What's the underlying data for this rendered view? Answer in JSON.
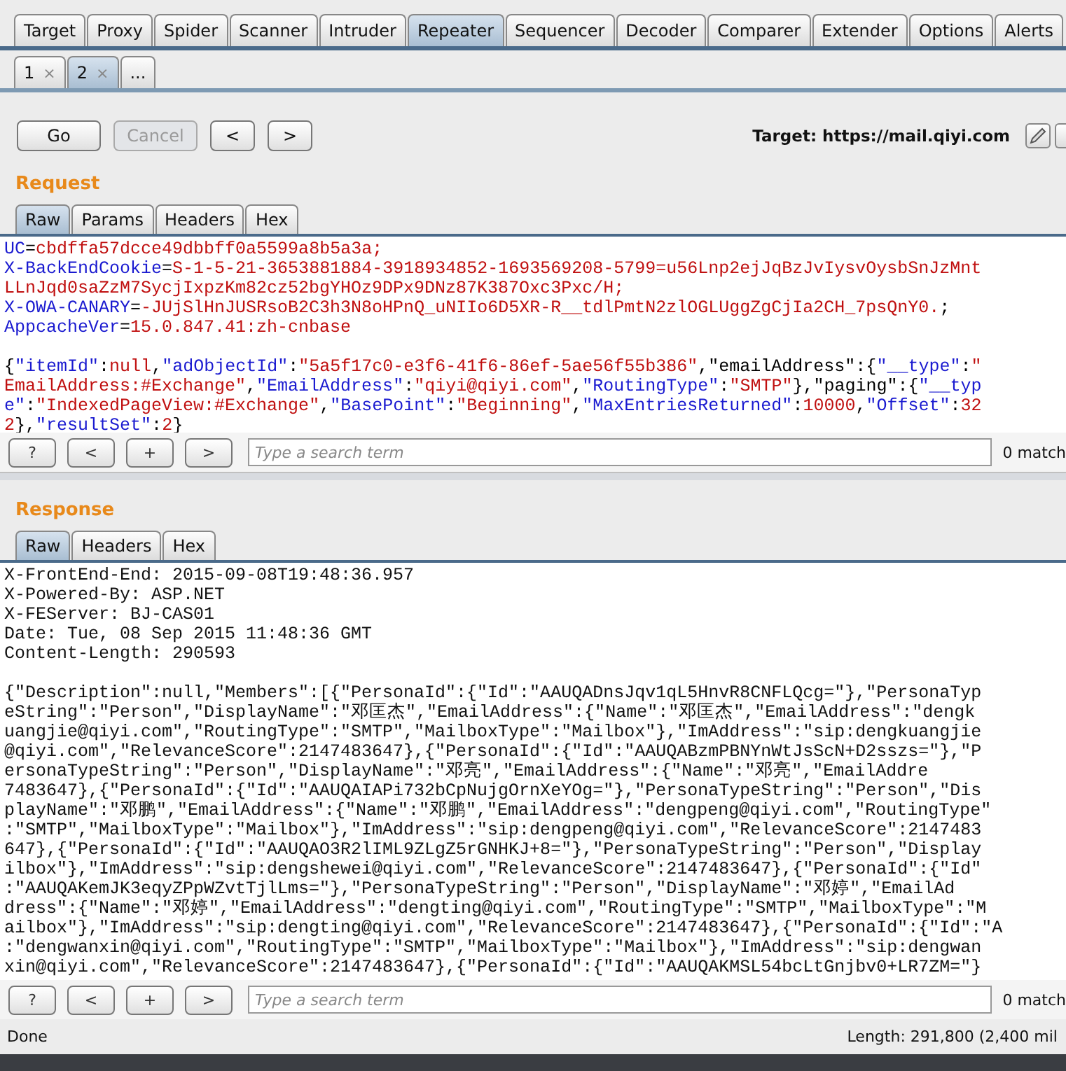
{
  "main_tabs": [
    {
      "label": "Target",
      "selected": false
    },
    {
      "label": "Proxy",
      "selected": false
    },
    {
      "label": "Spider",
      "selected": false
    },
    {
      "label": "Scanner",
      "selected": false
    },
    {
      "label": "Intruder",
      "selected": false
    },
    {
      "label": "Repeater",
      "selected": true
    },
    {
      "label": "Sequencer",
      "selected": false
    },
    {
      "label": "Decoder",
      "selected": false
    },
    {
      "label": "Comparer",
      "selected": false
    },
    {
      "label": "Extender",
      "selected": false
    },
    {
      "label": "Options",
      "selected": false
    },
    {
      "label": "Alerts",
      "selected": false
    }
  ],
  "repeater_tabs": [
    {
      "label": "1",
      "close": "×",
      "selected": false
    },
    {
      "label": "2",
      "close": "×",
      "selected": true
    },
    {
      "label": "...",
      "selected": false
    }
  ],
  "toolbar": {
    "buttons": [
      {
        "label": "Go",
        "disabled": false
      },
      {
        "label": "Cancel",
        "disabled": true
      },
      {
        "label": "<",
        "disabled": false
      },
      {
        "label": ">",
        "disabled": false
      }
    ],
    "target": "Target: https://mail.qiyi.com"
  },
  "request": {
    "title": "Request",
    "tabs": [
      {
        "label": "Raw",
        "selected": true
      },
      {
        "label": "Params",
        "selected": false
      },
      {
        "label": "Headers",
        "selected": false
      },
      {
        "label": "Hex",
        "selected": false
      }
    ],
    "header_lines": [
      [
        {
          "kind": "key",
          "text": "UC"
        },
        {
          "kind": "plain",
          "text": "="
        },
        {
          "kind": "value",
          "text": "cbdffa57dcce49dbbff0a5599a8b5a3a;"
        }
      ],
      [
        {
          "kind": "key",
          "text": "X-BackEndCookie"
        },
        {
          "kind": "plain",
          "text": "="
        },
        {
          "kind": "value",
          "text": "S-1-5-21-3653881884-3918934852-1693569208-5799=u56Lnp2ejJqBzJvIysvOysbSnJzMnt"
        }
      ],
      [
        {
          "kind": "value",
          "text": "LLnJqd0saZzM7SycjIxpzKm82cz52bgYHOz9DPx9DNz87K387Oxc3Pxc/H;"
        }
      ],
      [
        {
          "kind": "key",
          "text": "X-OWA-CANARY"
        },
        {
          "kind": "plain",
          "text": "="
        },
        {
          "kind": "value",
          "text": "-JUjSlHnJUSRsoB2C3h3N8oHPnQ_uNIIo6D5XR-R__tdlPmtN2zlOGLUggZgCjIa2CH_7psQnY0."
        },
        {
          "kind": "plain",
          "text": ";"
        }
      ],
      [
        {
          "kind": "key",
          "text": "AppcacheVer"
        },
        {
          "kind": "plain",
          "text": "="
        },
        {
          "kind": "value",
          "text": "15.0.847.41:zh-cnbase"
        }
      ]
    ],
    "body_lines": [
      [
        {
          "kind": "plain",
          "text": "{"
        },
        {
          "kind": "key",
          "text": "\"itemId\""
        },
        {
          "kind": "plain",
          "text": ":"
        },
        {
          "kind": "value",
          "text": "null"
        },
        {
          "kind": "plain",
          "text": ","
        },
        {
          "kind": "key",
          "text": "\"adObjectId\""
        },
        {
          "kind": "plain",
          "text": ":"
        },
        {
          "kind": "value",
          "text": "\"5a5f17c0-e3f6-41f6-86ef-5ae56f55b386\""
        },
        {
          "kind": "plain",
          "text": ",\"emailAddress\":{"
        },
        {
          "kind": "key",
          "text": "\"__type\""
        },
        {
          "kind": "plain",
          "text": ":"
        },
        {
          "kind": "value",
          "text": "\""
        }
      ],
      [
        {
          "kind": "value",
          "text": "EmailAddress:#Exchange\""
        },
        {
          "kind": "plain",
          "text": ","
        },
        {
          "kind": "key",
          "text": "\"EmailAddress\""
        },
        {
          "kind": "plain",
          "text": ":"
        },
        {
          "kind": "value",
          "text": "\"qiyi@qiyi.com\""
        },
        {
          "kind": "plain",
          "text": ","
        },
        {
          "kind": "key",
          "text": "\"RoutingType\""
        },
        {
          "kind": "plain",
          "text": ":"
        },
        {
          "kind": "value",
          "text": "\"SMTP\""
        },
        {
          "kind": "plain",
          "text": "},\"paging\":{"
        },
        {
          "kind": "key",
          "text": "\"__typ"
        }
      ],
      [
        {
          "kind": "key",
          "text": "e\""
        },
        {
          "kind": "plain",
          "text": ":"
        },
        {
          "kind": "value",
          "text": "\"IndexedPageView:#Exchange\""
        },
        {
          "kind": "plain",
          "text": ","
        },
        {
          "kind": "key",
          "text": "\"BasePoint\""
        },
        {
          "kind": "plain",
          "text": ":"
        },
        {
          "kind": "value",
          "text": "\"Beginning\""
        },
        {
          "kind": "plain",
          "text": ","
        },
        {
          "kind": "key",
          "text": "\"MaxEntriesReturned\""
        },
        {
          "kind": "plain",
          "text": ":"
        },
        {
          "kind": "value",
          "text": "10000"
        },
        {
          "kind": "plain",
          "text": ","
        },
        {
          "kind": "key",
          "text": "\"Offset\""
        },
        {
          "kind": "plain",
          "text": ":"
        },
        {
          "kind": "value",
          "text": "32"
        }
      ],
      [
        {
          "kind": "value",
          "text": "2"
        },
        {
          "kind": "plain",
          "text": "},"
        },
        {
          "kind": "key",
          "text": "\"resultSet\""
        },
        {
          "kind": "plain",
          "text": ":"
        },
        {
          "kind": "value",
          "text": "2"
        },
        {
          "kind": "plain",
          "text": "}"
        }
      ]
    ],
    "search": {
      "buttons": [
        "?",
        "<",
        "+",
        ">"
      ],
      "placeholder": "Type a search term",
      "matches": "0 match"
    }
  },
  "response": {
    "title": "Response",
    "tabs": [
      {
        "label": "Raw",
        "selected": true
      },
      {
        "label": "Headers",
        "selected": false
      },
      {
        "label": "Hex",
        "selected": false
      }
    ],
    "header_lines": [
      "X-FrontEnd-End: 2015-09-08T19:48:36.957",
      "X-Powered-By: ASP.NET",
      "X-FEServer: BJ-CAS01",
      "Date: Tue, 08 Sep 2015 11:48:36 GMT",
      "Content-Length: 290593"
    ],
    "body_lines": [
      "{\"Description\":null,\"Members\":[{\"PersonaId\":{\"Id\":\"AAUQADnsJqv1qL5HnvR8CNFLQcg=\"},\"PersonaTyp",
      "eString\":\"Person\",\"DisplayName\":\"邓匡杰\",\"EmailAddress\":{\"Name\":\"邓匡杰\",\"EmailAddress\":\"dengk",
      "uangjie@qiyi.com\",\"RoutingType\":\"SMTP\",\"MailboxType\":\"Mailbox\"},\"ImAddress\":\"sip:dengkuangjie",
      "@qiyi.com\",\"RelevanceScore\":2147483647},{\"PersonaId\":{\"Id\":\"AAUQABzmPBNYnWtJsScN+D2sszs=\"},\"P",
      "ersonaTypeString\":\"Person\",\"DisplayName\":\"邓亮\",\"EmailAddress\":{\"Name\":\"邓亮\",\"EmailAddre",
      "7483647},{\"PersonaId\":{\"Id\":\"AAUQAIAPi732bCpNujgOrnXeYOg=\"},\"PersonaTypeString\":\"Person\",\"Dis",
      "playName\":\"邓鹏\",\"EmailAddress\":{\"Name\":\"邓鹏\",\"EmailAddress\":\"dengpeng@qiyi.com\",\"RoutingType\"",
      ":\"SMTP\",\"MailboxType\":\"Mailbox\"},\"ImAddress\":\"sip:dengpeng@qiyi.com\",\"RelevanceScore\":2147483",
      "647},{\"PersonaId\":{\"Id\":\"AAUQAO3R2lIML9ZLgZ5rGNHKJ+8=\"},\"PersonaTypeString\":\"Person\",\"Display",
      "ilbox\"},\"ImAddress\":\"sip:dengshewei@qiyi.com\",\"RelevanceScore\":2147483647},{\"PersonaId\":{\"Id\"",
      ":\"AAUQAKemJK3eqyZPpWZvtTjlLms=\"},\"PersonaTypeString\":\"Person\",\"DisplayName\":\"邓婷\",\"EmailAd",
      "dress\":{\"Name\":\"邓婷\",\"EmailAddress\":\"dengting@qiyi.com\",\"RoutingType\":\"SMTP\",\"MailboxType\":\"M",
      "ailbox\"},\"ImAddress\":\"sip:dengting@qiyi.com\",\"RelevanceScore\":2147483647},{\"PersonaId\":{\"Id\":\"A",
      ":\"dengwanxin@qiyi.com\",\"RoutingType\":\"SMTP\",\"MailboxType\":\"Mailbox\"},\"ImAddress\":\"sip:dengwan",
      "xin@qiyi.com\",\"RelevanceScore\":2147483647},{\"PersonaId\":{\"Id\":\"AAUQAKMSL54bcLtGnjbv0+LR7ZM=\"}"
    ],
    "search": {
      "buttons": [
        "?",
        "<",
        "+",
        ">"
      ],
      "placeholder": "Type a search term",
      "matches": "0 match"
    }
  },
  "status_bar": {
    "left": "Done",
    "right": "Length: 291,800 (2,400 mil"
  }
}
